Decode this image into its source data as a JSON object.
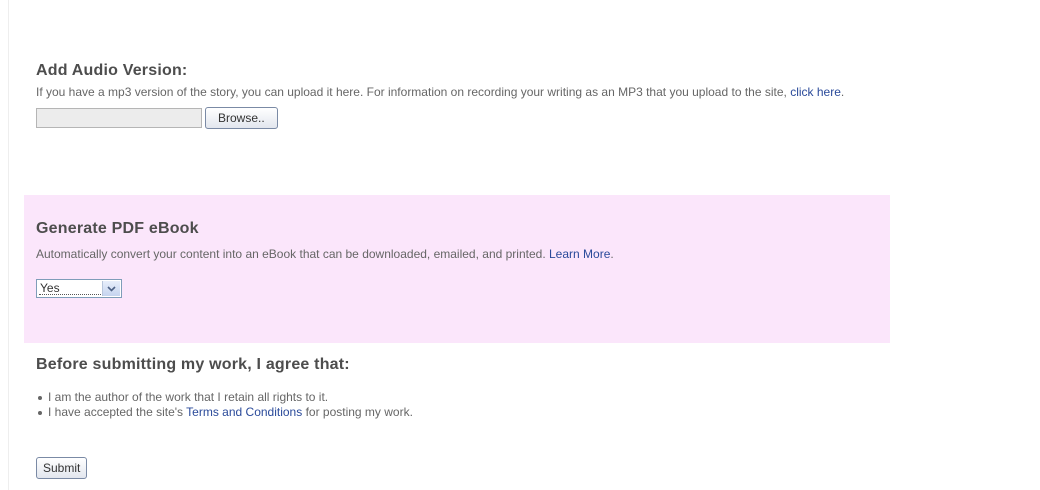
{
  "audio": {
    "heading": "Add Audio Version:",
    "description": "If you have a mp3 version of the story, you can upload it here. For information on recording your writing as an MP3 that you upload to the site, ",
    "link_text": "click here",
    "after_link": ".",
    "file_value": "",
    "browse_label": "Browse.."
  },
  "pdf": {
    "heading": "Generate PDF eBook",
    "description": "Automatically convert your content into an eBook that can be downloaded, emailed, and printed. ",
    "link_text": "Learn More",
    "after_link": ".",
    "selected_option": "Yes",
    "background_color": "#fbe6fb"
  },
  "agreement": {
    "heading": "Before submitting my work, I agree that:",
    "items": [
      {
        "text": "I am the author of the work that I retain all rights to it."
      },
      {
        "prefix": "I have accepted the site's ",
        "link_text": "Terms and Conditions",
        "suffix": " for posting my work."
      }
    ]
  },
  "submit_label": "Submit",
  "colors": {
    "link": "#2a4a9a",
    "heading": "#4d4d4d",
    "text": "#666666"
  }
}
